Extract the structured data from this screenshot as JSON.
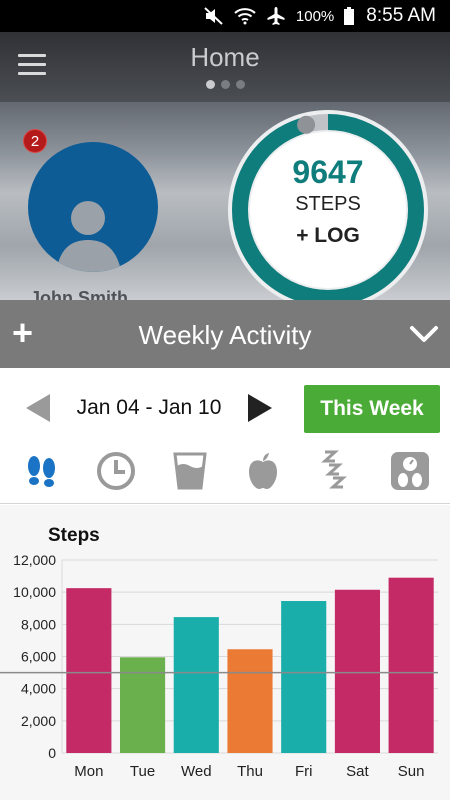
{
  "status_bar": {
    "battery_pct": "100%",
    "time": "8:55 AM"
  },
  "header": {
    "title": "Home",
    "page_count": 3,
    "active_page": 0
  },
  "profile": {
    "notification_count": "2",
    "name": "John Smith"
  },
  "steps_ring": {
    "steps": "9647",
    "label": "STEPS",
    "log_label": "+ LOG",
    "progress": 0.96
  },
  "activity_panel": {
    "add_label": "+",
    "title": "Weekly Activity"
  },
  "week_nav": {
    "date_range": "Jan 04 - Jan 10",
    "this_week_label": "This Week"
  },
  "metrics": [
    {
      "icon": "footsteps-icon",
      "active": true
    },
    {
      "icon": "clock-icon",
      "active": false
    },
    {
      "icon": "water-glass-icon",
      "active": false
    },
    {
      "icon": "apple-icon",
      "active": false
    },
    {
      "icon": "sleep-zzz-icon",
      "active": false
    },
    {
      "icon": "scale-icon",
      "active": false
    }
  ],
  "colors": {
    "accent_green": "#4aab36",
    "ring_teal": "#0f7d7c",
    "bar_magenta": "#c42a65",
    "bar_green": "#6ab04c",
    "bar_teal": "#1aaeab",
    "bar_orange": "#ea7a34",
    "icon_blue": "#1a73c4",
    "icon_grey": "#9a9a9a"
  },
  "chart_data": {
    "type": "bar",
    "title": "Steps",
    "categories": [
      "Mon",
      "Tue",
      "Wed",
      "Thu",
      "Fri",
      "Sat",
      "Sun"
    ],
    "values": [
      10250,
      5950,
      8450,
      6450,
      9450,
      10150,
      10900
    ],
    "bar_colors": [
      "#c42a65",
      "#6ab04c",
      "#1aaeab",
      "#ea7a34",
      "#1aaeab",
      "#c42a65",
      "#c42a65"
    ],
    "ylim": [
      0,
      12000
    ],
    "yticks": [
      "0",
      "2,000",
      "4,000",
      "6,000",
      "8,000",
      "10,000",
      "12,000"
    ],
    "goal_line": 5000,
    "grid": true
  }
}
